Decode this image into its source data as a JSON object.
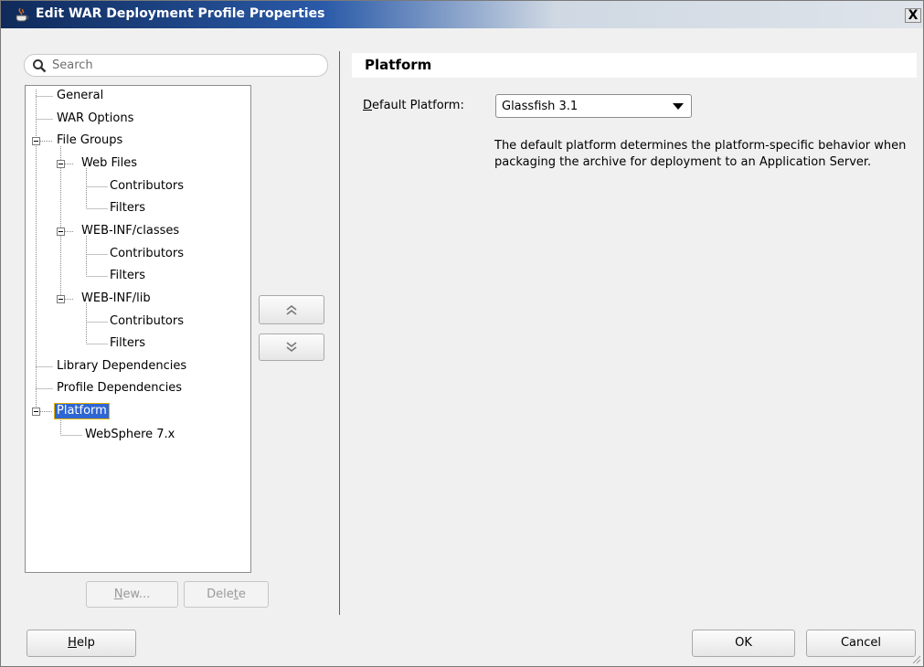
{
  "window": {
    "title": "Edit WAR Deployment Profile Properties",
    "close_label": "X"
  },
  "search": {
    "placeholder": "Search"
  },
  "tree": {
    "items": [
      {
        "label": "General"
      },
      {
        "label": "WAR Options"
      },
      {
        "label": "File Groups"
      },
      {
        "label": "Web Files"
      },
      {
        "label": "Contributors"
      },
      {
        "label": "Filters"
      },
      {
        "label": "WEB-INF/classes"
      },
      {
        "label": "Contributors"
      },
      {
        "label": "Filters"
      },
      {
        "label": "WEB-INF/lib"
      },
      {
        "label": "Contributors"
      },
      {
        "label": "Filters"
      },
      {
        "label": "Library Dependencies"
      },
      {
        "label": "Profile Dependencies"
      },
      {
        "label": "Platform",
        "selected": true
      },
      {
        "label": "WebSphere 7.x"
      }
    ]
  },
  "buttons": {
    "new_prefix": "",
    "new_mnemonic": "N",
    "new_suffix": "ew...",
    "delete_prefix": "Dele",
    "delete_mnemonic": "t",
    "delete_suffix": "e",
    "help_mnemonic": "H",
    "help_suffix": "elp",
    "ok_label": "OK",
    "cancel_label": "Cancel",
    "move_up_icon": "double-chevron-up-icon",
    "move_down_icon": "double-chevron-down-icon"
  },
  "panel": {
    "title": "Platform",
    "default_platform_label_mnemonic": "D",
    "default_platform_label_rest": "efault Platform:",
    "default_platform_value": "Glassfish 3.1",
    "description": "The default platform determines the platform-specific behavior when packaging the archive for deployment to an Application Server."
  },
  "colors": {
    "selection_bg": "#2e66d4",
    "selection_border": "#e8b000",
    "dialog_bg": "#f0f0f0"
  }
}
